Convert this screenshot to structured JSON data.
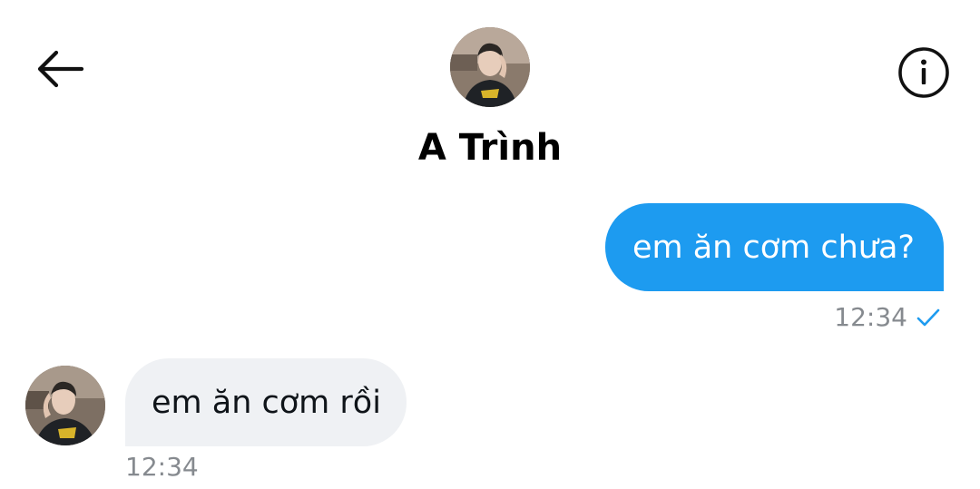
{
  "header": {
    "back_icon": "arrow-left-icon",
    "info_icon": "info-circle-icon",
    "contact_name": "A Trình"
  },
  "colors": {
    "accent": "#1d9bf0",
    "incoming_bubble": "#eff1f4",
    "timestamp": "#868a8f"
  },
  "messages": [
    {
      "direction": "outgoing",
      "text": "em ăn cơm chưa?",
      "time": "12:34",
      "status_icon": "check-icon"
    },
    {
      "direction": "incoming",
      "text": "em ăn cơm rồi",
      "time": "12:34"
    }
  ]
}
